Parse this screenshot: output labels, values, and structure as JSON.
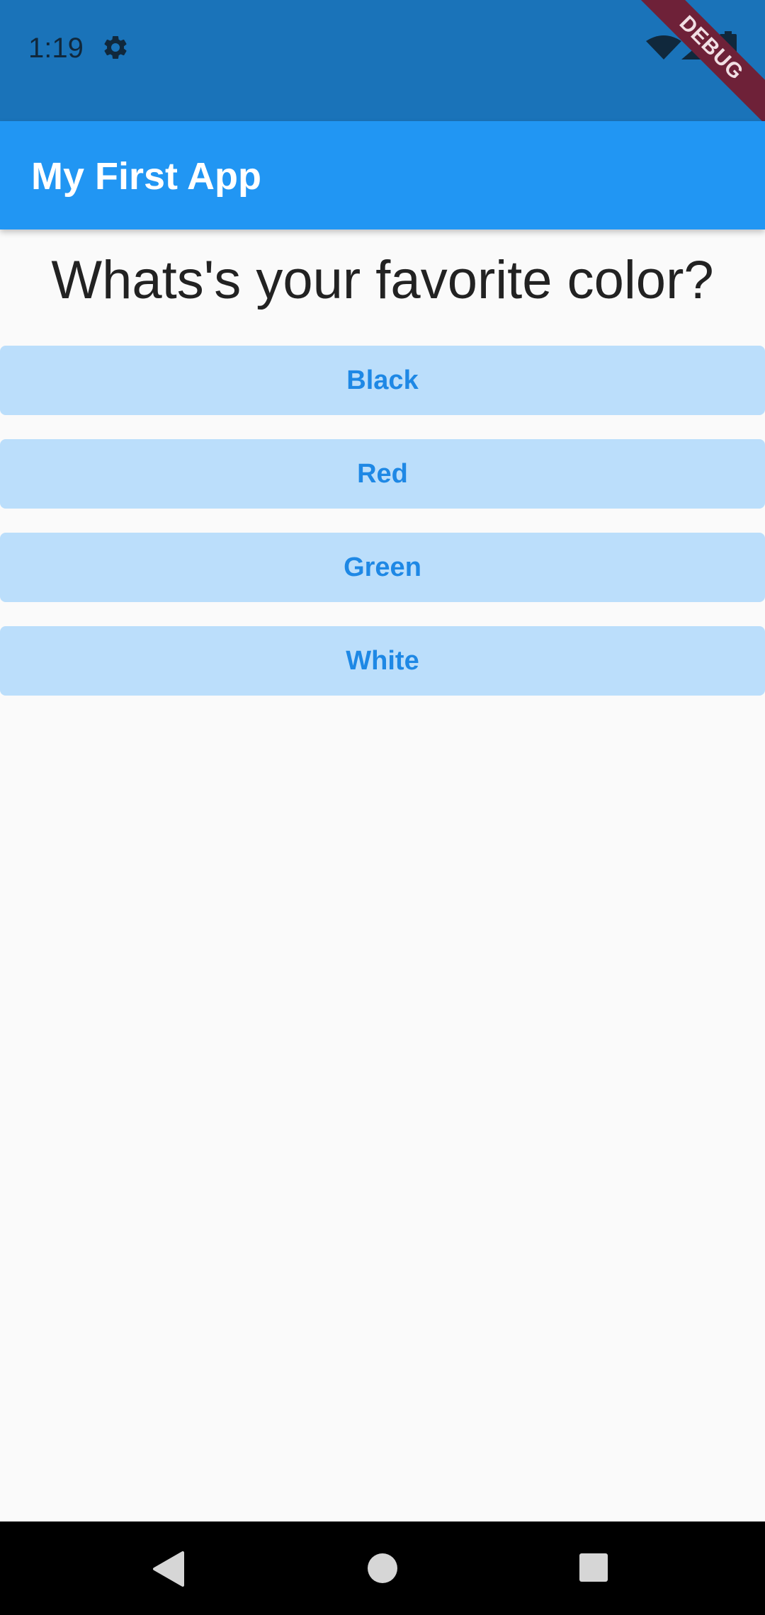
{
  "status_bar": {
    "time": "1:19",
    "icons": [
      "gear-icon",
      "wifi-icon",
      "signal-icon",
      "battery-icon"
    ]
  },
  "debug_banner": {
    "label": "DEBUG"
  },
  "app_bar": {
    "title": "My First App"
  },
  "main": {
    "question": "Whats's your favorite color?",
    "answers": [
      {
        "label": "Black"
      },
      {
        "label": "Red"
      },
      {
        "label": "Green"
      },
      {
        "label": "White"
      }
    ]
  },
  "nav_bar": {
    "icons": [
      "back-icon",
      "home-icon",
      "recents-icon"
    ]
  },
  "colors": {
    "status_bar": "#1a73b9",
    "app_bar": "#2196f3",
    "button_bg": "#bbdefb",
    "button_text": "#1e88e5",
    "background": "#fafafa",
    "debug_ribbon": "#6e2138"
  }
}
